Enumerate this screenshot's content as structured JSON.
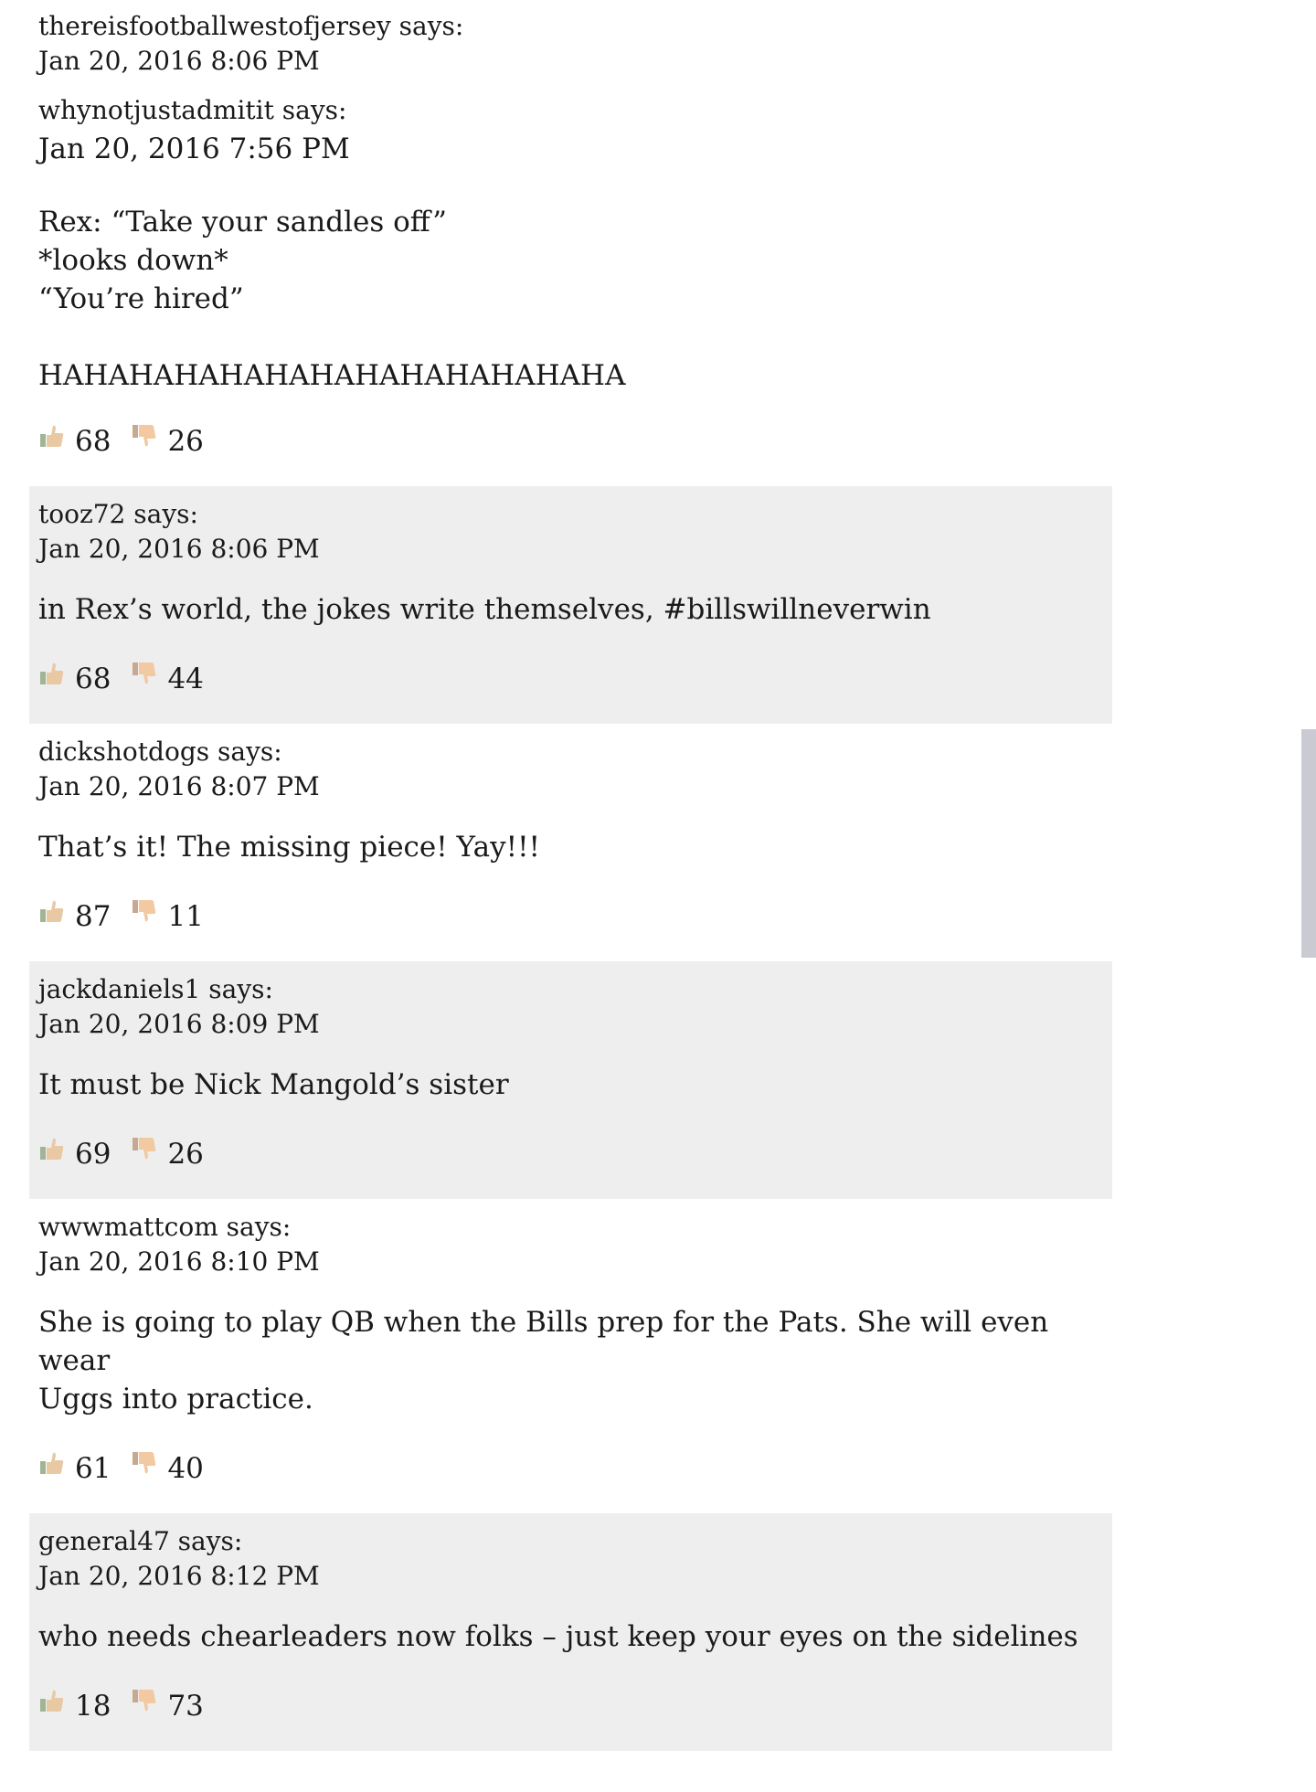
{
  "comments": [
    {
      "author": "thereisfootballwestofjersey",
      "says": "says:",
      "date": "Jan 20, 2016 8:06 PM",
      "quote": {
        "author": "whynotjustadmitit",
        "says": "says:",
        "date": "Jan 20, 2016 7:56 PM",
        "body": "Rex: “Take your sandles off”\n*looks down*\n“You’re hired”\n\nHAHAHAHAHAHAHAHAHAHAHAHAHA"
      },
      "up": "68",
      "down": "26"
    },
    {
      "author": "tooz72",
      "says": "says:",
      "date": "Jan 20, 2016 8:06 PM",
      "body": "in Rex’s world, the jokes write themselves, #billswillneverwin",
      "up": "68",
      "down": "44"
    },
    {
      "author": "dickshotdogs",
      "says": "says:",
      "date": "Jan 20, 2016 8:07 PM",
      "body": "That’s it! The missing piece! Yay!!!",
      "up": "87",
      "down": "11"
    },
    {
      "author": "jackdaniels1",
      "says": "says:",
      "date": "Jan 20, 2016 8:09 PM",
      "body": "It must be Nick Mangold’s sister",
      "up": "69",
      "down": "26"
    },
    {
      "author": "wwwmattcom",
      "says": "says:",
      "date": "Jan 20, 2016 8:10 PM",
      "body": "She is going to play QB when the Bills prep for the Pats. She will even wear\nUggs into practice.",
      "up": "61",
      "down": "40"
    },
    {
      "author": "general47",
      "says": "says:",
      "date": "Jan 20, 2016 8:12 PM",
      "body": "who needs chearleaders now folks – just keep your eyes on the sidelines",
      "up": "18",
      "down": "73"
    }
  ],
  "icons": {
    "thumb_up": "thumbs-up-icon",
    "thumb_down": "thumbs-down-icon"
  },
  "colors": {
    "alt_row": "#eeeeee",
    "scrollbar": "#c9cad2",
    "thumb_up_skin": "#e8c9a4",
    "thumb_up_cuff": "#9fb596",
    "thumb_down_skin": "#f2c9a0",
    "thumb_down_cuff": "#c8a890"
  }
}
